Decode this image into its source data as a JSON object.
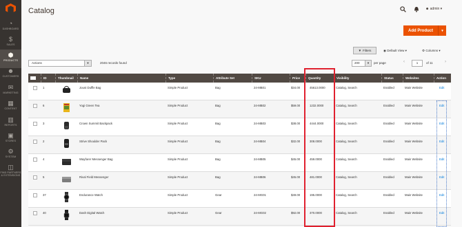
{
  "sidebar": {
    "items": [
      {
        "label": "DASHBOARD",
        "icon": "◔"
      },
      {
        "label": "SALES",
        "icon": "$"
      },
      {
        "label": "PRODUCTS",
        "icon": "⬢"
      },
      {
        "label": "CUSTOMERS",
        "icon": "☻"
      },
      {
        "label": "MARKETING",
        "icon": "✉"
      },
      {
        "label": "CONTENT",
        "icon": "▦"
      },
      {
        "label": "REPORTS",
        "icon": "▥"
      },
      {
        "label": "STORES",
        "icon": "▣"
      },
      {
        "label": "SYSTEM",
        "icon": "⚙"
      },
      {
        "label": "FIND PARTNERS & EXTENSIONS",
        "icon": "◫"
      }
    ]
  },
  "header": {
    "title": "Catalog",
    "user": "admin"
  },
  "add_product": "Add Product",
  "toolbar": {
    "filters": "Filters",
    "default_view": "Default View",
    "columns": "Columns",
    "actions": "Actions",
    "records": "2046 records found",
    "per_page_value": "200",
    "per_page_label": "per page",
    "page": "1",
    "of_pages": "of 11"
  },
  "columns": [
    "ID",
    "Thumbnail",
    "Name",
    "Type",
    "Attribute Set",
    "SKU",
    "Price",
    "Quantity",
    "Visibility",
    "Status",
    "Websites",
    "Action"
  ],
  "rows": [
    {
      "id": "1",
      "name": "Joust Duffle Bag",
      "type": "Simple Product",
      "attr": "Bag",
      "sku": "24-MB01",
      "price": "$34.00",
      "qty": "45613.0000",
      "vis": "Catalog, Search",
      "status": "Enabled",
      "web": "Main Website",
      "action": "Edit",
      "thumb": "duffle"
    },
    {
      "id": "6",
      "name": "Yogi Green Tea",
      "type": "Simple Product",
      "attr": "Bag",
      "sku": "24-MB02",
      "price": "$59.00",
      "qty": "1232.0000",
      "vis": "Catalog, Search",
      "status": "Enabled",
      "web": "Main Website",
      "action": "Edit",
      "thumb": "tea"
    },
    {
      "id": "3",
      "name": "Crown Summit Backpack",
      "type": "Simple Product",
      "attr": "Bag",
      "sku": "24-MB03",
      "price": "$38.00",
      "qty": "4444.0000",
      "vis": "Catalog, Search",
      "status": "Enabled",
      "web": "Main Website",
      "action": "Edit",
      "thumb": "backpack"
    },
    {
      "id": "2",
      "name": "Strive Shoulder Pack",
      "type": "Simple Product",
      "attr": "Bag",
      "sku": "24-MB04",
      "price": "$32.00",
      "qty": "308.0000",
      "vis": "Catalog, Search",
      "status": "Enabled",
      "web": "Main Website",
      "action": "Edit",
      "thumb": "shoulder"
    },
    {
      "id": "4",
      "name": "Wayfarer Messenger Bag",
      "type": "Simple Product",
      "attr": "Bag",
      "sku": "24-MB05",
      "price": "$45.00",
      "qty": "459.0000",
      "vis": "Catalog, Search",
      "status": "Enabled",
      "web": "Main Website",
      "action": "Edit",
      "thumb": "messenger"
    },
    {
      "id": "5",
      "name": "Rival Field Messenger",
      "type": "Simple Product",
      "attr": "Bag",
      "sku": "24-MB06",
      "price": "$45.00",
      "qty": "481.0000",
      "vis": "Catalog, Search",
      "status": "Enabled",
      "web": "Main Website",
      "action": "Edit",
      "thumb": "field"
    },
    {
      "id": "37",
      "name": "Endurance Watch",
      "type": "Simple Product",
      "attr": "Gear",
      "sku": "24-MG01",
      "price": "$49.00",
      "qty": "195.0000",
      "vis": "Catalog, Search",
      "status": "Enabled",
      "web": "Main Website",
      "action": "Edit",
      "thumb": "watch"
    },
    {
      "id": "40",
      "name": "Dash Digital Watch",
      "type": "Simple Product",
      "attr": "Gear",
      "sku": "24-MG02",
      "price": "$92.00",
      "qty": "370.0000",
      "vis": "Catalog, Search",
      "status": "Enabled",
      "web": "Main Website",
      "action": "Edit",
      "thumb": "watch2"
    }
  ],
  "colors": {
    "accent": "#eb5202",
    "header_bg": "#514943",
    "sidebar": "#373330",
    "highlight": "#e0202e",
    "link": "#007bdb"
  }
}
